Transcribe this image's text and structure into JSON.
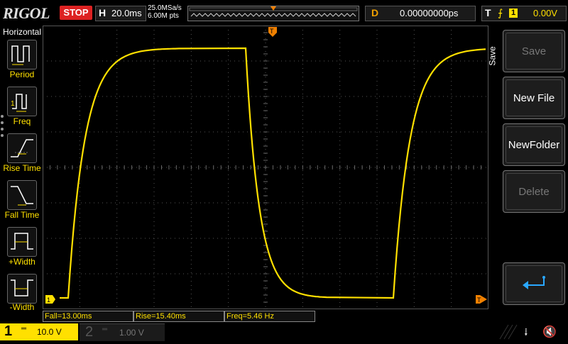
{
  "topbar": {
    "logo": "RIGOL",
    "run_state": "STOP",
    "timebase_prefix": "H",
    "timebase": "20.0ms",
    "sample_rate": "25.0MSa/s",
    "memory_depth": "6.00M pts",
    "trigger_marker": "T",
    "delay_prefix": "D",
    "delay": "0.00000000ps",
    "trigger_prefix": "T",
    "trigger_source": "1",
    "trigger_level": "0.00V"
  },
  "left_menu": {
    "title": "Horizontal",
    "items": [
      {
        "label": "Period",
        "icon": "period-icon"
      },
      {
        "label": "Freq",
        "icon": "freq-icon"
      },
      {
        "label": "Rise Time",
        "icon": "rise-time-icon"
      },
      {
        "label": "Fall Time",
        "icon": "fall-time-icon"
      },
      {
        "label": "+Width",
        "icon": "positive-width-icon"
      },
      {
        "label": "-Width",
        "icon": "negative-width-icon"
      }
    ]
  },
  "right_panel": {
    "tab_label": "Save",
    "buttons": [
      {
        "label": "Save",
        "enabled": false
      },
      {
        "label": "New File",
        "enabled": true
      },
      {
        "label": "NewFolder",
        "enabled": true
      },
      {
        "label": "Delete",
        "enabled": false
      },
      {
        "label": "",
        "icon": "return-arrow-icon",
        "enabled": true
      }
    ]
  },
  "measurements": {
    "fall": "Fall=13.00ms",
    "rise": "Rise=15.40ms",
    "freq": "Freq=5.46 Hz"
  },
  "markers": {
    "ch1_ground": "1",
    "trigger_level_marker": "T",
    "trigger_position_marker": "T"
  },
  "bottombar": {
    "ch1_number": "1",
    "ch1_coupling": "DC",
    "ch1_scale": "10.0 V",
    "ch2_number": "2",
    "ch2_coupling": "DC",
    "ch2_scale": "1.00 V"
  },
  "colors": {
    "ch1": "#ffe000",
    "stop": "#dd2222",
    "delay": "#f0a000",
    "trigger_marker": "#f08000"
  }
}
